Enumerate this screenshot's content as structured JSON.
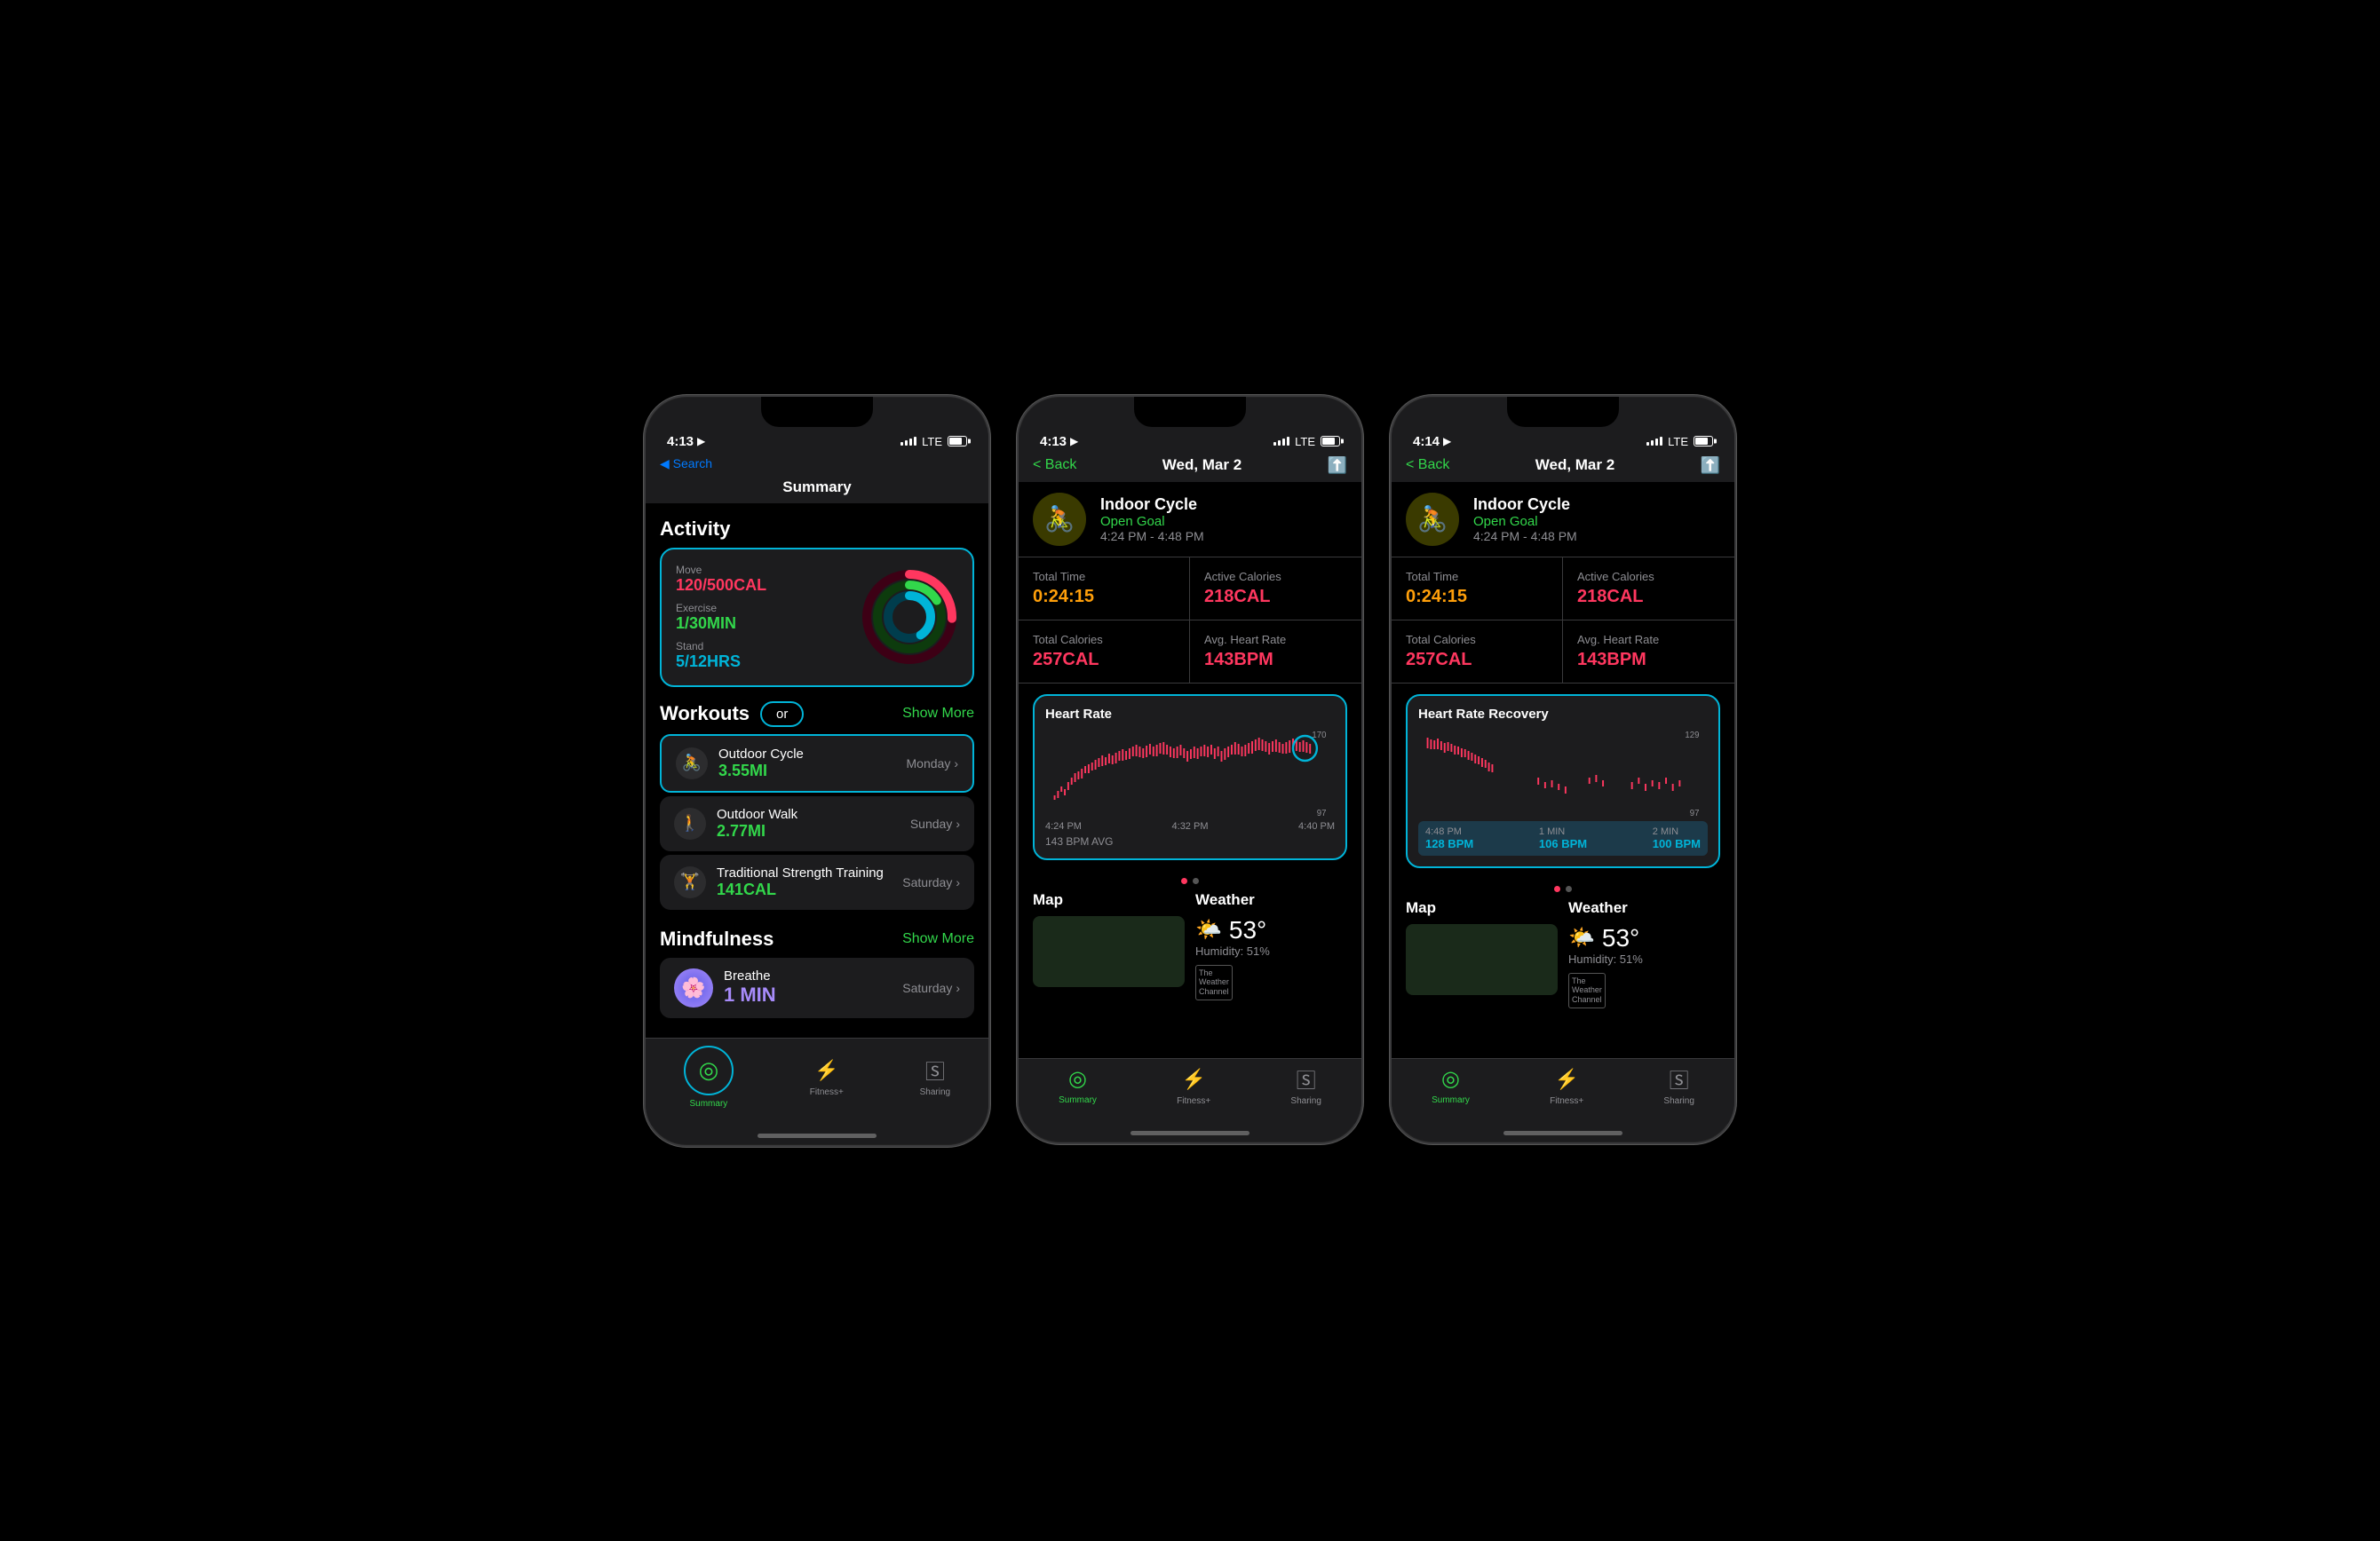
{
  "phone1": {
    "statusBar": {
      "time": "4:13",
      "signal": "LTE",
      "hasLocation": true
    },
    "nav": {
      "search": "◀ Search",
      "title": "Summary"
    },
    "activity": {
      "sectionTitle": "Activity",
      "move": {
        "label": "Move",
        "value": "120/500CAL"
      },
      "exercise": {
        "label": "Exercise",
        "value": "1/30MIN"
      },
      "stand": {
        "label": "Stand",
        "value": "5/12HRS"
      }
    },
    "workouts": {
      "sectionTitle": "Workouts",
      "showMore": "Show More",
      "orLabel": "or",
      "items": [
        {
          "name": "Outdoor Cycle",
          "value": "3.55MI",
          "day": "Monday"
        },
        {
          "name": "Outdoor Walk",
          "value": "2.77MI",
          "day": "Sunday"
        },
        {
          "name": "Traditional Strength Training",
          "value": "141CAL",
          "day": "Saturday"
        }
      ]
    },
    "mindfulness": {
      "sectionTitle": "Mindfulness",
      "showMore": "Show More",
      "name": "Breathe",
      "duration": "1 MIN",
      "day": "Saturday"
    },
    "tabBar": {
      "summary": {
        "label": "Summary",
        "active": true
      },
      "fitness": {
        "label": "Fitness+",
        "active": false
      },
      "sharing": {
        "label": "Sharing",
        "active": false
      }
    }
  },
  "phone2": {
    "statusBar": {
      "time": "4:13"
    },
    "nav": {
      "back": "< Back",
      "title": "Wed, Mar 2"
    },
    "workout": {
      "type": "Indoor Cycle",
      "goal": "Open Goal",
      "timeRange": "4:24 PM - 4:48 PM"
    },
    "stats": [
      {
        "label": "Total Time",
        "value": "0:24:15",
        "color": "orange"
      },
      {
        "label": "Active Calories",
        "value": "218CAL",
        "color": "red"
      },
      {
        "label": "Total Calories",
        "value": "257CAL",
        "color": "red"
      },
      {
        "label": "Avg. Heart Rate",
        "value": "143BPM",
        "color": "red"
      }
    ],
    "heartRate": {
      "title": "Heart Rate",
      "yMax": "170",
      "yMin": "97",
      "times": [
        "4:24 PM",
        "4:32 PM",
        "4:40 PM"
      ],
      "avg": "143 BPM AVG"
    },
    "map": {
      "label": "Map"
    },
    "weather": {
      "label": "Weather",
      "icon": "🌤️",
      "temp": "53°",
      "humidity": "Humidity: 51%"
    },
    "tabBar": {
      "summary": {
        "label": "Summary",
        "active": true
      },
      "fitness": {
        "label": "Fitness+",
        "active": false
      },
      "sharing": {
        "label": "Sharing",
        "active": false
      }
    }
  },
  "phone3": {
    "statusBar": {
      "time": "4:14"
    },
    "nav": {
      "back": "< Back",
      "title": "Wed, Mar 2"
    },
    "workout": {
      "type": "Indoor Cycle",
      "goal": "Open Goal",
      "timeRange": "4:24 PM - 4:48 PM"
    },
    "stats": [
      {
        "label": "Total Time",
        "value": "0:24:15",
        "color": "orange"
      },
      {
        "label": "Active Calories",
        "value": "218CAL",
        "color": "red"
      },
      {
        "label": "Total Calories",
        "value": "257CAL",
        "color": "red"
      },
      {
        "label": "Avg. Heart Rate",
        "value": "143BPM",
        "color": "red"
      }
    ],
    "heartRateRecovery": {
      "title": "Heart Rate Recovery",
      "yMax": "129",
      "yMin": "97",
      "times": [
        "4:48 PM",
        "1 MIN",
        "2 MIN"
      ],
      "bpm": [
        "128 BPM",
        "106 BPM",
        "100 BPM"
      ]
    },
    "map": {
      "label": "Map"
    },
    "weather": {
      "label": "Weather",
      "icon": "🌤️",
      "temp": "53°",
      "humidity": "Humidity: 51%"
    },
    "tabBar": {
      "summary": {
        "label": "Summary",
        "active": true
      },
      "fitness": {
        "label": "Fitness+",
        "active": false
      },
      "sharing": {
        "label": "Sharing",
        "active": false
      }
    }
  }
}
